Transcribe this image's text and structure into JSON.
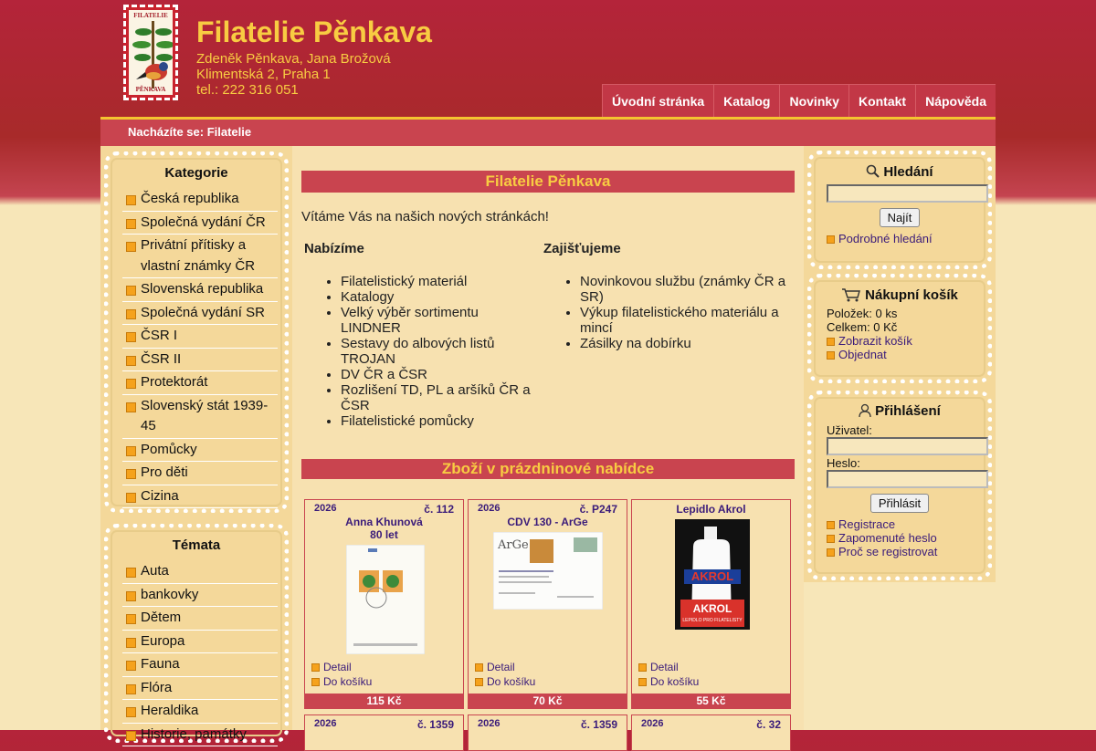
{
  "header": {
    "title": "Filatelie Pěnkava",
    "logo_top": "FILATELIE",
    "logo_bottom": "PĚNKAVA",
    "owners": "Zdeněk Pěnkava, Jana Brožová",
    "address": "Klimentská 2, Praha 1",
    "phone": "tel.: 222 316 051"
  },
  "nav": [
    "Úvodní stránka",
    "Katalog",
    "Novinky",
    "Kontakt",
    "Nápověda"
  ],
  "breadcrumb": "Nacházíte se: Filatelie",
  "categories": {
    "title": "Kategorie",
    "items": [
      "Česká republika",
      "Společná vydání ČR",
      "Privátní přítisky a vlastní známky ČR",
      "Slovenská republika",
      "Společná vydání SR",
      "ČSR I",
      "ČSR II",
      "Protektorát",
      "Slovenský stát 1939-45",
      "Pomůcky",
      "Pro děti",
      "Cizina"
    ]
  },
  "topics": {
    "title": "Témata",
    "items": [
      "Auta",
      "bankovky",
      "Dětem",
      "Europa",
      "Fauna",
      "Flóra",
      "Heraldika",
      "Historie, památky"
    ]
  },
  "search": {
    "title": "Hledání",
    "button": "Najít",
    "advanced": "Podrobné hledání"
  },
  "cart": {
    "title": "Nákupní košík",
    "items": "Položek: 0 ks",
    "total": "Celkem: 0 Kč",
    "show": "Zobrazit košík",
    "order": "Objednat"
  },
  "login": {
    "title": "Přihlášení",
    "user_label": "Uživatel:",
    "pass_label": "Heslo:",
    "button": "Přihlásit",
    "register": "Registrace",
    "forgot": "Zapomenuté heslo",
    "why": "Proč se registrovat"
  },
  "main": {
    "title": "Filatelie Pěnkava",
    "welcome": "Vítáme Vás na našich nových stránkách!",
    "offer_title": "Nabízíme",
    "offer": [
      "Filatelistický materiál",
      "Katalogy",
      "Velký výběr sortimentu LINDNER",
      "Sestavy do albových listů TROJAN",
      "DV ČR a ČSR",
      "Rozlišení TD, PL a aršíků ČR a ČSR",
      "Filatelistické pomůcky"
    ],
    "provide_title": "Zajišťujeme",
    "provide": [
      "Novinkovou službu (známky ČR a SR)",
      "Výkup filatelistického materiálu a mincí",
      "Zásilky na dobírku"
    ],
    "holiday_title": "Zboží v prázdninové nabídce"
  },
  "products": [
    {
      "year": "2026",
      "number": "č. 112",
      "name1": "Anna Khunová",
      "name2": "80 let",
      "detail": "Detail",
      "cart": "Do košíku",
      "price": "115 Kč"
    },
    {
      "year": "2026",
      "number": "č. P247",
      "name1": "CDV 130 - ArGe",
      "name2": "",
      "detail": "Detail",
      "cart": "Do košíku",
      "price": "70 Kč"
    },
    {
      "year": "",
      "number": "",
      "name1": "Lepidlo Akrol",
      "name2": "",
      "detail": "Detail",
      "cart": "Do košíku",
      "price": "55 Kč"
    },
    {
      "year": "2026",
      "number": "č. 1359"
    },
    {
      "year": "2026",
      "number": "č. 1359"
    },
    {
      "year": "2026",
      "number": "č. 32"
    }
  ],
  "images": {
    "akrol_text": "AKROL",
    "akrol_label": "LEPIDLO PRO FILATELISTY",
    "cdv_text": "ArGe"
  }
}
